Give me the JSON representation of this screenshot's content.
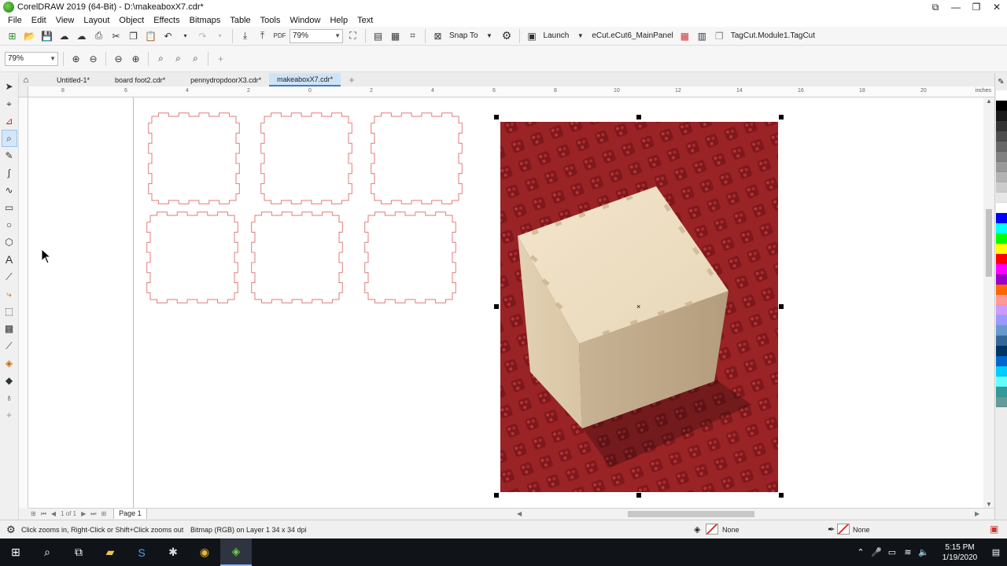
{
  "window": {
    "title": "CorelDRAW 2019 (64-Bit) - D:\\makeaboxX7.cdr*",
    "controls": [
      "minimize",
      "maximize",
      "close"
    ]
  },
  "menu": [
    "File",
    "Edit",
    "View",
    "Layout",
    "Object",
    "Effects",
    "Bitmaps",
    "Table",
    "Tools",
    "Window",
    "Help",
    "Text"
  ],
  "toolbar": {
    "zoom_value": "79%",
    "snap_label": "Snap To",
    "launch_label": "Launch",
    "macro_label": "eCut.eCut6_MainPanel",
    "module_label": "TagCut.Module1.TagCut"
  },
  "propbar": {
    "zoom_value": "79%"
  },
  "tabs": [
    {
      "label": "Untitled-1*",
      "active": false
    },
    {
      "label": "board foot2.cdr*",
      "active": false
    },
    {
      "label": "pennydropdoorX3.cdr*",
      "active": false
    },
    {
      "label": "makeaboxX7.cdr*",
      "active": true
    }
  ],
  "ruler": {
    "unit": "inches",
    "ticks": [
      "8",
      "6",
      "4",
      "2",
      "0",
      "2",
      "4",
      "6",
      "8",
      "10",
      "12",
      "14",
      "16",
      "18",
      "20"
    ]
  },
  "canvas": {
    "shape_color": "#e07a7a",
    "photo_alt": "Bitmap"
  },
  "pagebar": {
    "page_of": "1 of 1",
    "page_label": "Page 1"
  },
  "status": {
    "hint": "Click zooms in, Right-Click or Shift+Click zooms out",
    "object_info": "Bitmap (RGB) on Layer 1 34 x 34 dpi",
    "fill_label": "None",
    "outline_label": "None"
  },
  "palette": [
    "#ffffff",
    "#000000",
    "#1a1a1a",
    "#333333",
    "#4d4d4d",
    "#666666",
    "#808080",
    "#999999",
    "#b3b3b3",
    "#cccccc",
    "#e6e6e6",
    "#ffffff",
    "#0000ff",
    "#00ffff",
    "#00ff00",
    "#ffff00",
    "#ff0000",
    "#ff00ff",
    "#9900cc",
    "#ff6600",
    "#ff9999",
    "#cc99ff",
    "#9999ff",
    "#6699cc",
    "#336699",
    "#003366",
    "#0066cc",
    "#00ccff",
    "#66ffff",
    "#339999",
    "#669999"
  ],
  "taskbar": {
    "time": "5:15 PM",
    "date": "1/19/2020"
  }
}
